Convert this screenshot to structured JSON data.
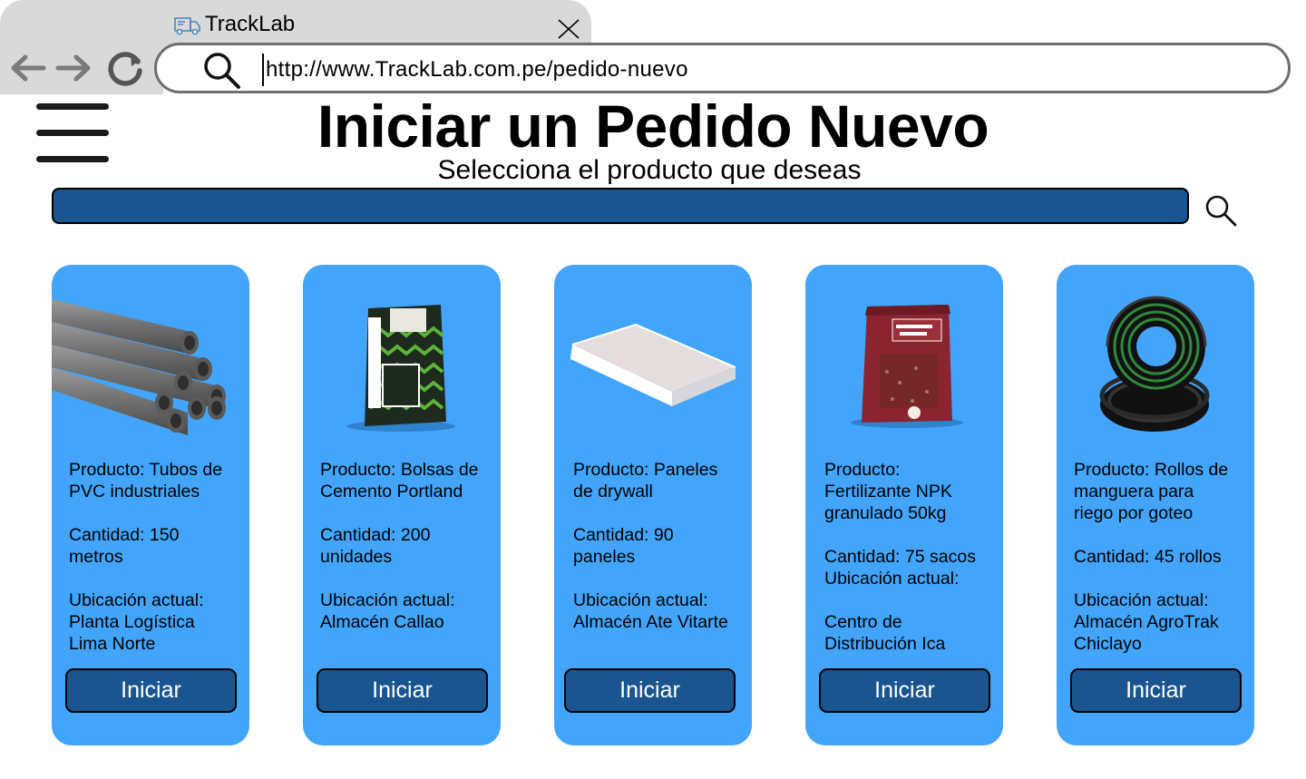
{
  "browser": {
    "tab_title": "TrackLab",
    "url": "http://www.TrackLab.com.pe/pedido-nuevo"
  },
  "icons": {
    "tab": "truck-icon",
    "close": "close-icon",
    "back": "arrow-left-icon",
    "forward": "arrow-right-icon",
    "reload": "reload-icon",
    "url_search": "search-icon",
    "menu": "hamburger-menu-icon",
    "product_search": "search-icon"
  },
  "header": {
    "title": "Iniciar un Pedido Nuevo",
    "subtitle": "Selecciona el producto que deseas"
  },
  "search": {
    "value": "",
    "placeholder": ""
  },
  "products": [
    {
      "image": "pvc-pipes-image",
      "product": "Producto: Tubos de\nPVC industriales",
      "quantity": "Cantidad: 150\nmetros",
      "location": "Ubicación actual:\nPlanta Logística\nLima Norte",
      "button": "Iniciar"
    },
    {
      "image": "cement-bag-image",
      "product": "Producto: Bolsas de\nCemento Portland",
      "quantity": "Cantidad: 200\nunidades",
      "location": "Ubicación actual:\nAlmacén Callao",
      "button": "Iniciar"
    },
    {
      "image": "drywall-panel-image",
      "product": "Producto: Paneles\nde drywall",
      "quantity": "Cantidad: 90\npaneles",
      "location": "Ubicación actual:\nAlmacén Ate Vitarte",
      "button": "Iniciar"
    },
    {
      "image": "fertilizer-bag-image",
      "product": "Producto:\nFertilizante NPK\ngranulado 50kg",
      "quantity": "Cantidad: 75 sacos\nUbicación actual:",
      "location": "Centro de\nDistribución Ica",
      "button": "Iniciar"
    },
    {
      "image": "hose-roll-image",
      "product": "Producto: Rollos de\nmanguera para\nriego por goteo",
      "quantity": "Cantidad: 45 rollos",
      "location": "Ubicación actual:\nAlmacén AgroTrak\nChiclayo",
      "button": "Iniciar"
    }
  ],
  "colors": {
    "card_background": "#42a5fb",
    "button_background": "#1a5590",
    "search_background": "#1a5590",
    "chrome_gray": "#d9d9d9"
  }
}
